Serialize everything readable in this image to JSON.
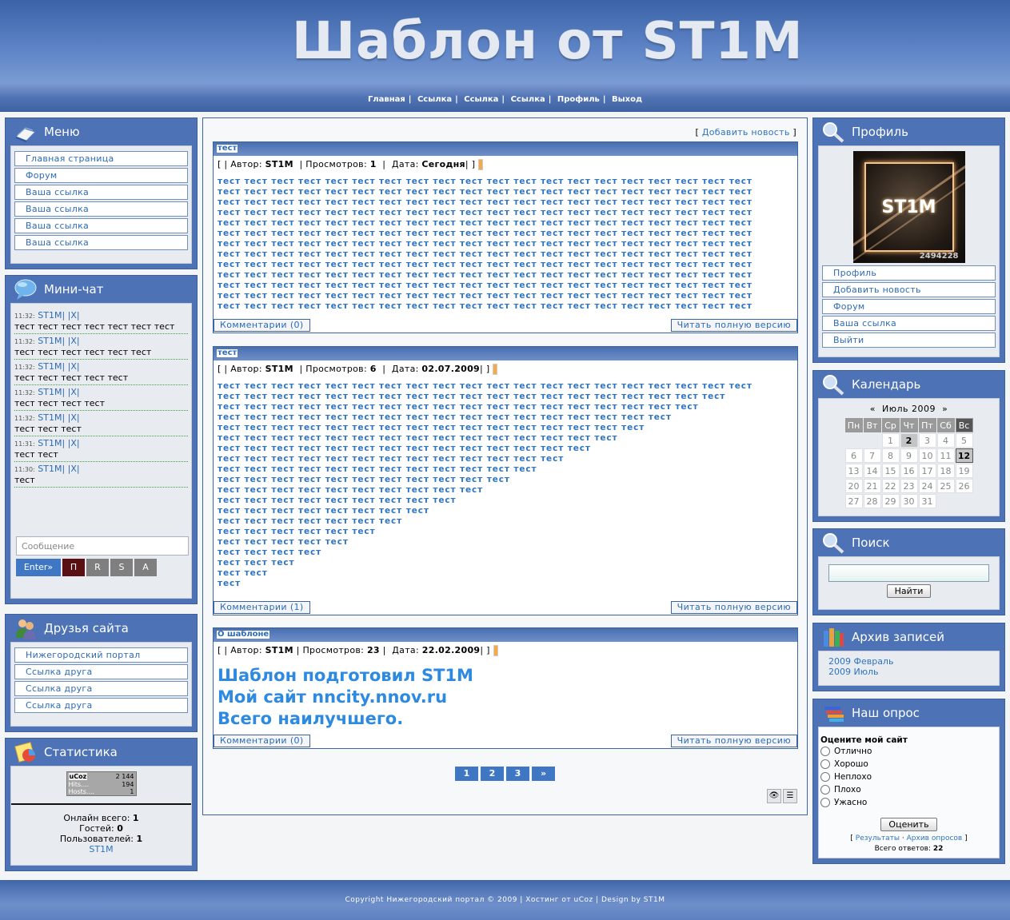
{
  "header": {
    "title": "Шаблон от ST1M",
    "nav": [
      "Главная",
      "Ссылка",
      "Ссылка",
      "Ссылка",
      "Профиль",
      "Выход"
    ]
  },
  "menu": {
    "title": "Меню",
    "items": [
      "Главная страница",
      "Форум",
      "Ваша ссылка",
      "Ваша ссылка",
      "Ваша ссылка",
      "Ваша ссылка"
    ]
  },
  "chat": {
    "title": "Мини-чат",
    "messages": [
      {
        "time": "11:32:",
        "nick": "ST1M",
        "actions": "| |X|",
        "text": "тест тест тест тест тест тест тест"
      },
      {
        "time": "11:32:",
        "nick": "ST1M",
        "actions": "| |X|",
        "text": "тест тест тест тест тест тест"
      },
      {
        "time": "11:32:",
        "nick": "ST1M",
        "actions": "| |X|",
        "text": "тест тест тест тест тест"
      },
      {
        "time": "11:32:",
        "nick": "ST1M",
        "actions": "| |X|",
        "text": "тест тест тест тест"
      },
      {
        "time": "11:32:",
        "nick": "ST1M",
        "actions": "| |X|",
        "text": "тест тест тест"
      },
      {
        "time": "11:31:",
        "nick": "ST1M",
        "actions": "| |X|",
        "text": "тест тест"
      },
      {
        "time": "11:30:",
        "nick": "ST1M",
        "actions": "| |X|",
        "text": "тест"
      }
    ],
    "input_placeholder": "Сообщение",
    "enter_label": "Enter»",
    "buttons": [
      "П",
      "R",
      "S",
      "A"
    ]
  },
  "friends": {
    "title": "Друзья сайта",
    "items": [
      "Нижегородский портал",
      "Ссылка друга",
      "Ссылка друга",
      "Ссылка друга"
    ]
  },
  "stats": {
    "title": "Статистика",
    "counter": {
      "brand": "uCoz",
      "total": "2 144",
      "hits_label": "Hits....",
      "hits": "194",
      "hosts_label": "Hosts....",
      "hosts": "1"
    },
    "online_label": "Онлайн всего:",
    "online": "1",
    "guests_label": "Гостей:",
    "guests": "0",
    "users_label": "Пользователей:",
    "users": "1",
    "user_name": "ST1M"
  },
  "main": {
    "add_news": "Добавить новость",
    "entries": [
      {
        "title": "тест",
        "author_label": "Автор:",
        "author": "ST1M",
        "views_label": "Просмотров:",
        "views": "1",
        "date_label": "Дата:",
        "date": "Сегодня",
        "lines": [
          "тест тест тест тест тест тест тест тест тест тест тест тест тест тест тест тест тест тест тест тест",
          "тест тест тест тест тест тест тест тест тест тест тест тест тест тест тест тест тест тест тест тест",
          "тест тест тест тест тест тест тест тест тест тест тест тест тест тест тест тест тест тест тест тест",
          "тест тест тест тест тест тест тест тест тест тест тест тест тест тест тест тест тест тест тест тест",
          "тест тест тест тест тест тест тест тест тест тест тест тест тест тест тест тест тест тест тест тест",
          "тест тест тест тест тест тест тест тест тест тест тест тест тест тест тест тест тест тест тест тест",
          "тест тест тест тест тест тест тест тест тест тест тест тест тест тест тест тест тест тест тест тест",
          "тест тест тест тест тест тест тест тест тест тест тест тест тест тест тест тест тест тест тест тест",
          "тест тест тест тест тест тест тест тест тест тест тест тест тест тест тест тест тест тест тест тест",
          "тест тест тест тест тест тест тест тест тест тест тест тест тест тест тест тест тест тест тест тест",
          "тест тест тест тест тест тест тест тест тест тест тест тест тест тест тест тест тест тест тест тест",
          "тест тест тест тест тест тест тест тест тест тест тест тест тест тест тест тест тест тест тест тест",
          "тест тест тест тест тест тест тест тест тест тест тест тест тест тест тест тест тест тест тест тест"
        ],
        "comments": "Комментарии (0)",
        "read_more": "Читать полную версию"
      },
      {
        "title": "тест",
        "author_label": "Автор:",
        "author": "ST1M",
        "views_label": "Просмотров:",
        "views": "6",
        "date_label": "Дата:",
        "date": "02.07.2009",
        "lines": [
          "тест тест тест тест тест тест тест тест тест тест тест тест тест тест тест тест тест тест тест тест",
          "тест тест тест тест тест тест тест тест тест тест тест тест тест тест тест тест тест тест тест",
          "тест тест тест тест тест тест тест тест тест тест тест тест тест тест тест тест тест тест",
          "тест тест тест тест тест тест тест тест тест тест тест тест тест тест тест тест тест",
          "тест тест тест тест тест тест тест тест тест тест тест тест тест тест тест тест",
          "тест тест тест тест тест тест тест тест тест тест тест тест тест тест тест",
          "тест тест тест тест тест тест тест тест тест тест тест тест тест тест",
          "тест тест тест тест тест тест тест тест тест тест тест тест тест",
          "тест тест тест тест тест тест тест тест тест тест тест тест",
          "тест тест тест тест тест тест тест тест тест тест тест",
          "тест тест тест тест тест тест тест тест тест тест",
          "тест тест тест тест тест тест тест тест тест",
          "тест тест тест тест тест тест тест тест",
          "тест тест тест тест тест тест тест",
          "тест тест тест тест тест тест",
          "тест тест тест тест тест",
          "тест тест тест тест",
          "тест тест тест",
          "тест тест",
          "тест"
        ],
        "comments": "Комментарии (1)",
        "read_more": "Читать полную версию"
      },
      {
        "title": "О шаблоне",
        "author_label": "Автор:",
        "author": "ST1M",
        "views_label": "Просмотров:",
        "views": "23",
        "date_label": "Дата:",
        "date": "22.02.2009",
        "lines": [
          "Шаблон подготовил ST1M",
          "Мой сайт nncity.nnov.ru",
          "Всего наилучшего."
        ],
        "comments": "Комментарии (0)",
        "read_more": "Читать полную версию"
      }
    ],
    "pages": [
      "1",
      "2",
      "3",
      "»"
    ]
  },
  "profile": {
    "title": "Профиль",
    "avatar_text": "ST1M",
    "avatar_number": "2494228",
    "items": [
      "Профиль",
      "Добавить новость",
      "Форум",
      "Ваша ссылка",
      "Выйти"
    ]
  },
  "calendar": {
    "title": "Календарь",
    "prev": "«",
    "month": "Июль 2009",
    "next": "»",
    "days_of_week": [
      "Пн",
      "Вт",
      "Ср",
      "Чт",
      "Пт",
      "Сб",
      "Вс"
    ],
    "weeks": [
      [
        "",
        "",
        "1",
        "2",
        "3",
        "4",
        "5"
      ],
      [
        "6",
        "7",
        "8",
        "9",
        "10",
        "11",
        "12"
      ],
      [
        "13",
        "14",
        "15",
        "16",
        "17",
        "18",
        "19"
      ],
      [
        "20",
        "21",
        "22",
        "23",
        "24",
        "25",
        "26"
      ],
      [
        "27",
        "28",
        "29",
        "30",
        "31",
        "",
        ""
      ]
    ],
    "highlighted": [
      "2"
    ],
    "today": "12"
  },
  "search": {
    "title": "Поиск",
    "button": "Найти"
  },
  "archive": {
    "title": "Архив записей",
    "items": [
      "2009 Февраль",
      "2009 Июль"
    ]
  },
  "poll": {
    "title": "Наш опрос",
    "question": "Оцените мой сайт",
    "options": [
      "Отлично",
      "Хорошо",
      "Неплохо",
      "Плохо",
      "Ужасно"
    ],
    "vote": "Оценить",
    "results": "Результаты",
    "archive": "Архив опросов",
    "total_label": "Всего ответов:",
    "total": "22"
  },
  "footer": {
    "text": "Copyright Нижегородский портал © 2009 | Хостинг от uCoz | Design by ST1M"
  },
  "colors": {
    "primary": "#4d72b5",
    "link": "#2e74c0",
    "accent": "#3f77c4",
    "chat_send": "#3f77c4",
    "chat_p": "#5a0f12",
    "chat_btn": "#7f7f7f"
  }
}
